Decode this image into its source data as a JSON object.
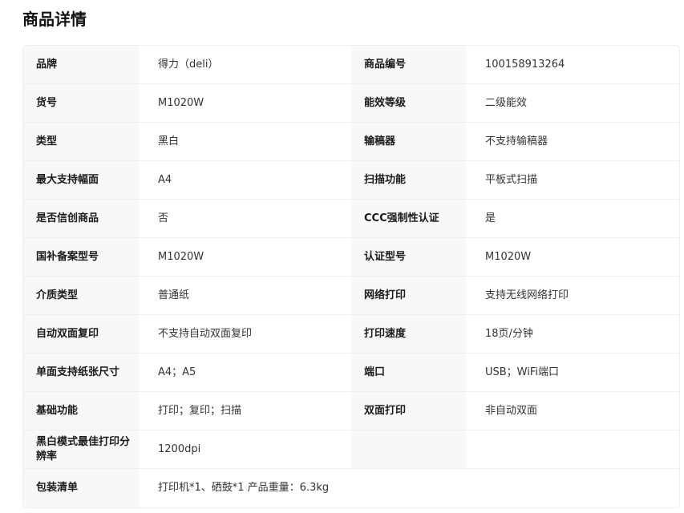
{
  "title": "商品详情",
  "rows": [
    {
      "l1": "品牌",
      "v1": "得力（deli）",
      "l2": "商品编号",
      "v2": "100158913264"
    },
    {
      "l1": "货号",
      "v1": "M1020W",
      "l2": "能效等级",
      "v2": "二级能效"
    },
    {
      "l1": "类型",
      "v1": "黑白",
      "l2": "输稿器",
      "v2": "不支持输稿器"
    },
    {
      "l1": "最大支持幅面",
      "v1": "A4",
      "l2": "扫描功能",
      "v2": "平板式扫描"
    },
    {
      "l1": "是否信创商品",
      "v1": "否",
      "l2": "CCC强制性认证",
      "v2": "是"
    },
    {
      "l1": "国补备案型号",
      "v1": "M1020W",
      "l2": "认证型号",
      "v2": "M1020W"
    },
    {
      "l1": "介质类型",
      "v1": "普通纸",
      "l2": "网络打印",
      "v2": "支持无线网络打印"
    },
    {
      "l1": "自动双面复印",
      "v1": "不支持自动双面复印",
      "l2": "打印速度",
      "v2": "18页/分钟"
    },
    {
      "l1": "单面支持纸张尺寸",
      "v1": "A4；A5",
      "l2": "端口",
      "v2": "USB；WiFi端口"
    },
    {
      "l1": "基础功能",
      "v1": "打印；复印；扫描",
      "l2": "双面打印",
      "v2": "非自动双面"
    },
    {
      "l1": "黑白模式最佳打印分辨率",
      "v1": "1200dpi",
      "l2": "",
      "v2": ""
    }
  ],
  "packing": {
    "label": "包装清单",
    "value": "打印机*1、硒鼓*1 产品重量：6.3kg"
  }
}
